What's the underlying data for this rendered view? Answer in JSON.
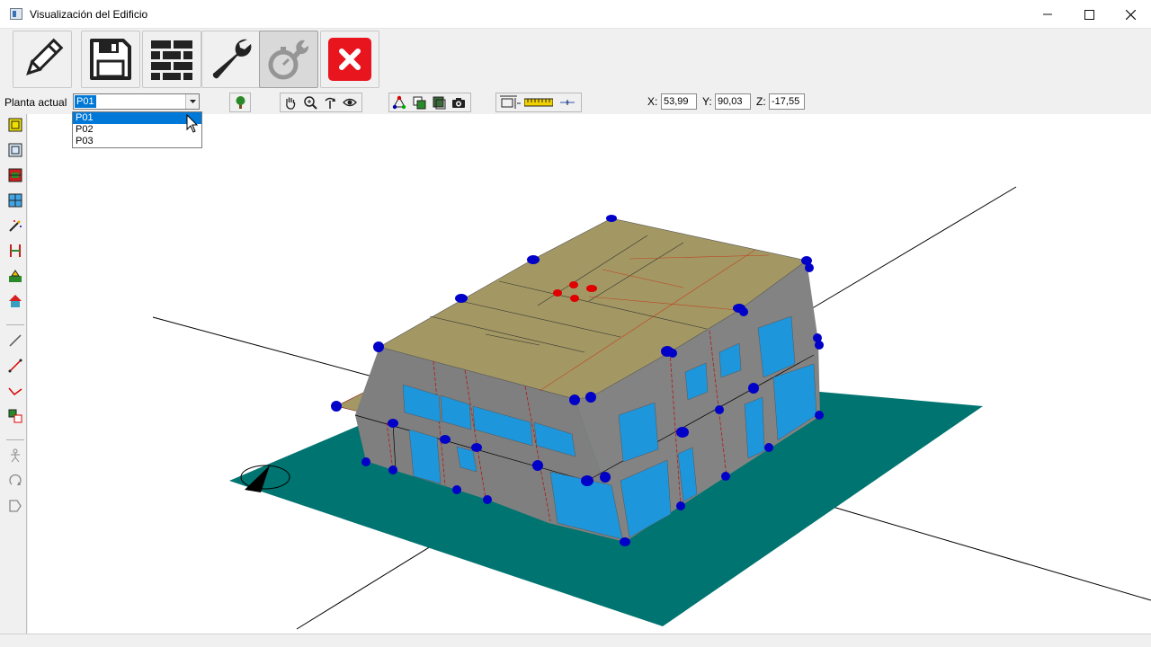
{
  "window": {
    "title": "Visualización del Edificio"
  },
  "main_toolbar": {
    "buttons": [
      {
        "icon": "pencil-icon",
        "state": "normal"
      },
      {
        "icon": "save-disk-icon",
        "state": "normal"
      },
      {
        "icon": "brick-wall-icon",
        "state": "normal"
      },
      {
        "icon": "wrench-icon",
        "state": "normal"
      },
      {
        "icon": "stopwatch-wrench-icon",
        "state": "pressed-disabled"
      },
      {
        "icon": "close-red-icon",
        "state": "normal"
      }
    ]
  },
  "floor_selector": {
    "label": "Planta actual",
    "selected": "P01",
    "options": [
      "P01",
      "P02",
      "P03"
    ]
  },
  "coordinates": {
    "x_label": "X:",
    "x_value": "53,99",
    "y_label": "Y:",
    "y_value": "90,03",
    "z_label": "Z:",
    "z_value": "-17,55"
  },
  "colors": {
    "ground": "#007470",
    "roof": "#a39863",
    "wall": "#808080",
    "window": "#1e96dc",
    "vertex": "#0000c8",
    "selected_vertex": "#e00000",
    "close_button": "#e8151f"
  }
}
